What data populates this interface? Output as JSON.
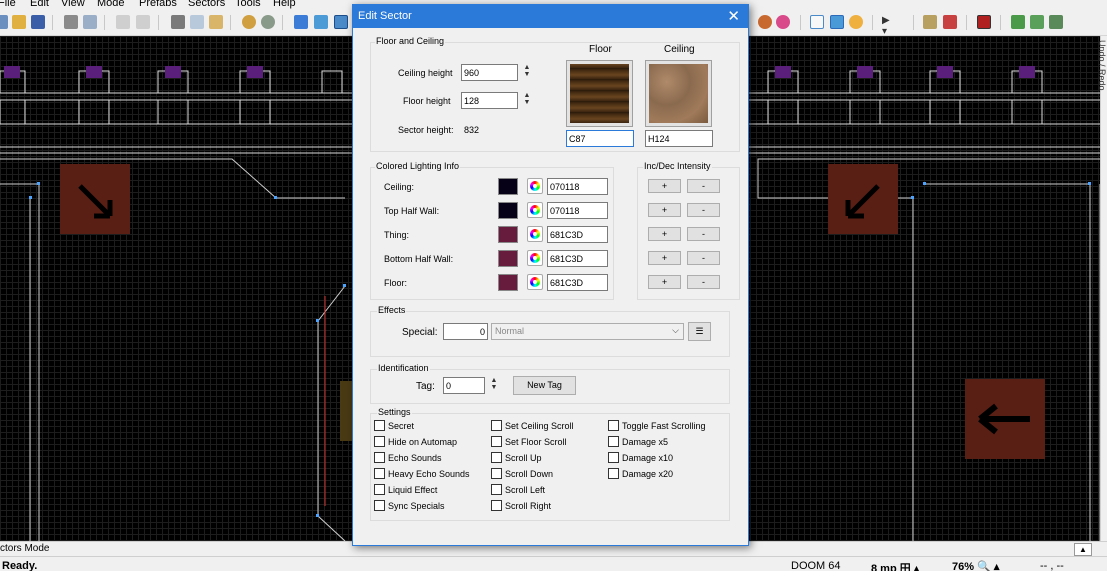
{
  "menu": [
    "File",
    "Edit",
    "View",
    "Mode",
    "Prefabs",
    "Sectors",
    "Tools",
    "Help"
  ],
  "dialog": {
    "title": "Edit Sector",
    "close_glyph": "✕",
    "floor_ceiling": {
      "group_label": "Floor and Ceiling",
      "ceiling_height_label": "Ceiling height",
      "ceiling_height": "960",
      "floor_height_label": "Floor height",
      "floor_height": "128",
      "sector_height_label": "Sector height:",
      "sector_height": "832",
      "floor_col_label": "Floor",
      "ceiling_col_label": "Ceiling",
      "floor_texture": "C87",
      "ceiling_texture": "H124"
    },
    "lighting": {
      "group_label": "Colored Lighting Info",
      "rows": [
        {
          "label": "Ceiling:",
          "hex": "070118",
          "color": "#070118"
        },
        {
          "label": "Top Half Wall:",
          "hex": "070118",
          "color": "#070118"
        },
        {
          "label": "Thing:",
          "hex": "681C3D",
          "color": "#681C3D"
        },
        {
          "label": "Bottom Half Wall:",
          "hex": "681C3D",
          "color": "#681C3D"
        },
        {
          "label": "Floor:",
          "hex": "681C3D",
          "color": "#681C3D"
        }
      ],
      "intensity_label": "Inc/Dec Intensity",
      "plus": "+",
      "minus": "-"
    },
    "effects": {
      "group_label": "Effects",
      "special_label": "Special:",
      "special_value": "0",
      "special_type": "Normal"
    },
    "identification": {
      "group_label": "Identification",
      "tag_label": "Tag:",
      "tag_value": "0",
      "new_tag_label": "New Tag"
    },
    "settings": {
      "group_label": "Settings",
      "col1": [
        "Secret",
        "Hide on Automap",
        "Echo Sounds",
        "Heavy Echo Sounds",
        "Liquid Effect",
        "Sync Specials"
      ],
      "col2": [
        "Set Ceiling Scroll",
        "Set Floor Scroll",
        "Scroll Up",
        "Scroll Down",
        "Scroll Left",
        "Scroll Right"
      ],
      "col3": [
        "Toggle Fast Scrolling",
        "Damage x5",
        "Damage x10",
        "Damage x20"
      ]
    }
  },
  "side_panel_label": "Undo / Redo",
  "mode_label": "ctors Mode",
  "status": {
    "ready": "Ready.",
    "game": "DOOM 64",
    "grid": "8 mp 田 ▴",
    "zoom": "76% 🔍 ▴",
    "coords": "--  ,  --"
  },
  "colors": {
    "accent": "#2b79d8",
    "map_line": "#c8c8c8",
    "vertex": "#4aa3ff",
    "arrow_tile": "#5a1f14"
  }
}
